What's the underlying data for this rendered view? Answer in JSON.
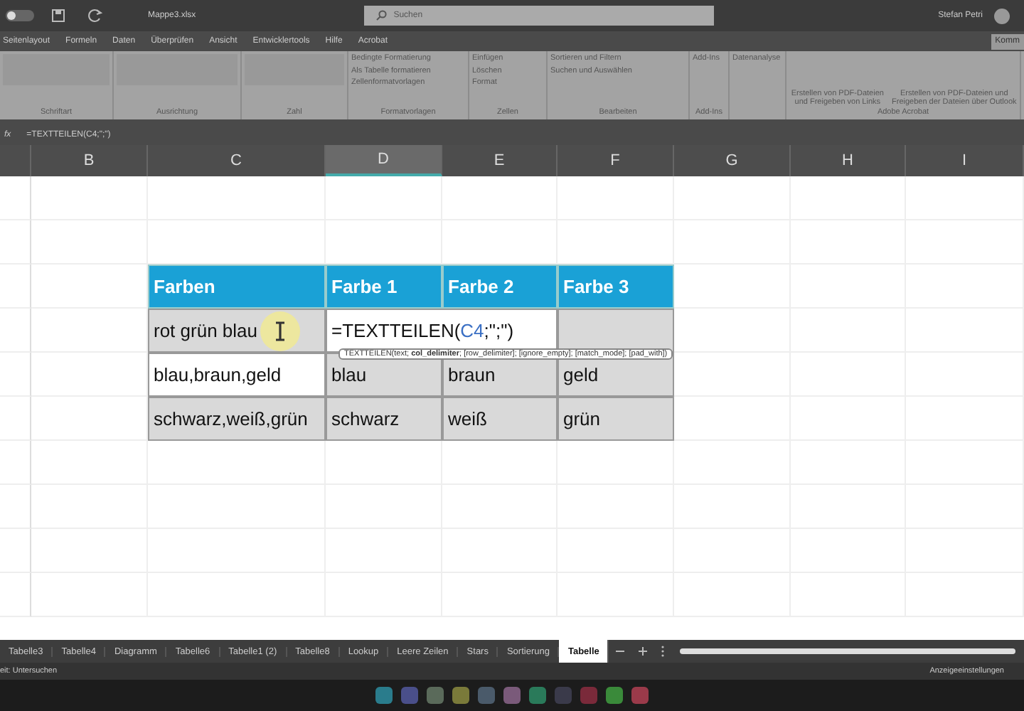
{
  "title_bar": {
    "autosave_on": false,
    "file_name": "Mappe3.xlsx",
    "search_placeholder": "Suchen",
    "user": "Stefan Petri"
  },
  "menu": [
    "Seitenlayout",
    "Formeln",
    "Daten",
    "Überprüfen",
    "Ansicht",
    "Entwicklertools",
    "Hilfe",
    "Acrobat"
  ],
  "comments_button": "Komm",
  "ribbon_groups": [
    {
      "label": "Schriftart"
    },
    {
      "label": "Ausrichtung"
    },
    {
      "label": "Zahl"
    },
    {
      "label": "Formatvorlagen",
      "buttons": [
        "Bedingte Formatierung",
        "Als Tabelle formatieren",
        "Zellenformatvorlagen"
      ]
    },
    {
      "label": "Zellen",
      "buttons": [
        "Einfügen",
        "Löschen",
        "Format"
      ]
    },
    {
      "label": "Bearbeiten",
      "buttons": [
        "Sortieren und Filtern",
        "Suchen und Auswählen"
      ]
    },
    {
      "label": "Add-Ins",
      "buttons": [
        "Add-Ins"
      ]
    },
    {
      "buttons": [
        "Datenanalyse"
      ]
    },
    {
      "label": "Adobe Acrobat",
      "buttons": [
        "Erstellen von PDF-Dateien und Freigeben von Links",
        "Erstellen von PDF-Dateien und Freigeben der Dateien über Outlook"
      ]
    }
  ],
  "formula_bar": {
    "fx_label": "fx",
    "value": "=TEXTTEILEN(C4;\";\")"
  },
  "columns": [
    {
      "label": "B",
      "selected": false
    },
    {
      "label": "C",
      "selected": false
    },
    {
      "label": "D",
      "selected": true
    },
    {
      "label": "E",
      "selected": false
    },
    {
      "label": "F",
      "selected": false
    },
    {
      "label": "G",
      "selected": false
    },
    {
      "label": "H",
      "selected": false
    },
    {
      "label": "I",
      "selected": false
    }
  ],
  "table": {
    "columns": [
      "Farben",
      "Farbe 1",
      "Farbe 2",
      "Farbe 3"
    ],
    "rows": [
      [
        {
          "text": "rot grün blau",
          "shaded": true
        },
        {
          "kind": "formula",
          "shaded": false,
          "before": "=TEXTTEILEN(",
          "ref": "C4",
          "after": ";\";\")"
        },
        {
          "text": "",
          "shaded": true
        }
      ],
      [
        {
          "text": "blau,braun,geld",
          "shaded": false
        },
        {
          "text": "blau",
          "shaded": true
        },
        {
          "text": "braun",
          "shaded": true
        },
        {
          "text": "geld",
          "shaded": true
        }
      ],
      [
        {
          "text": "schwarz,weiß,grün",
          "shaded": true
        },
        {
          "text": "schwarz",
          "shaded": true
        },
        {
          "text": "weiß",
          "shaded": true
        },
        {
          "text": "grün",
          "shaded": true
        }
      ]
    ]
  },
  "tooltip": "TEXTTEILEN(text; **col_delimiter**; [row_delimiter]; [ignore_empty]; [match_mode]; [pad_with])",
  "sheet_tabs": [
    {
      "label": "Tabelle3",
      "selected": false
    },
    {
      "label": "Tabelle4",
      "selected": false
    },
    {
      "label": "Diagramm",
      "selected": false
    },
    {
      "label": "Tabelle6",
      "selected": false
    },
    {
      "label": "Tabelle1 (2)",
      "selected": false
    },
    {
      "label": "Tabelle8",
      "selected": false
    },
    {
      "label": "Lookup",
      "selected": false
    },
    {
      "label": "Leere Zeilen",
      "selected": false
    },
    {
      "label": "Stars",
      "selected": false
    },
    {
      "label": "Sortierung",
      "selected": false
    },
    {
      "label": "Tabelle",
      "selected": true
    }
  ],
  "status_bar": {
    "left": "eit: Untersuchen",
    "right": "Anzeigeeinstellungen"
  }
}
